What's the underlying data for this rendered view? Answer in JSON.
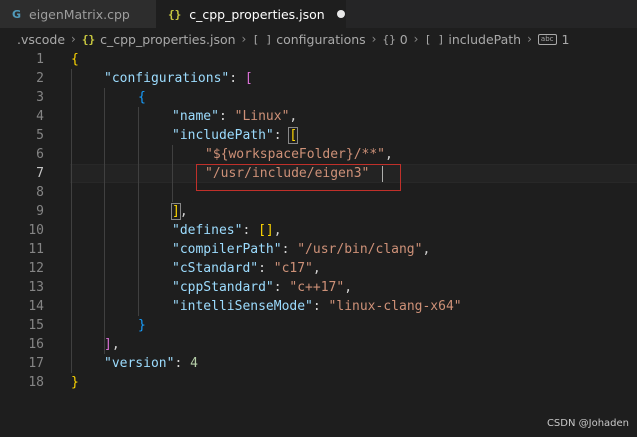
{
  "tabs": [
    {
      "icon": "G",
      "label": "eigenMatrix.cpp"
    },
    {
      "icon": "{}",
      "label": "c_cpp_properties.json"
    }
  ],
  "breadcrumb": {
    "folder": ".vscode",
    "file": "c_cpp_properties.json",
    "configurations": "configurations",
    "index": "0",
    "includePath": "includePath",
    "item": "1"
  },
  "code": {
    "line_numbers": [
      "1",
      "2",
      "3",
      "4",
      "5",
      "6",
      "7",
      "8",
      "9",
      "10",
      "11",
      "12",
      "13",
      "14",
      "15",
      "16",
      "17",
      "18"
    ],
    "keys": {
      "configurations": "\"configurations\"",
      "name": "\"name\"",
      "includePath": "\"includePath\"",
      "defines": "\"defines\"",
      "compilerPath": "\"compilerPath\"",
      "cStandard": "\"cStandard\"",
      "cppStandard": "\"cppStandard\"",
      "intelliSenseMode": "\"intelliSenseMode\"",
      "version": "\"version\""
    },
    "values": {
      "name": "\"Linux\"",
      "include1": "\"${workspaceFolder}/**\"",
      "include2": "\"/usr/include/eigen3\"",
      "compilerPath": "\"/usr/bin/clang\"",
      "cStandard": "\"c17\"",
      "cppStandard": "\"c++17\"",
      "intelliSenseMode": "\"linux-clang-x64\"",
      "version": "4"
    }
  },
  "watermark": "CSDN @Johaden",
  "colors": {
    "background": "#1e1e1e",
    "key": "#9cdcfe",
    "string": "#ce9178",
    "number": "#b5cea8",
    "highlight_box": "#c0302a"
  }
}
